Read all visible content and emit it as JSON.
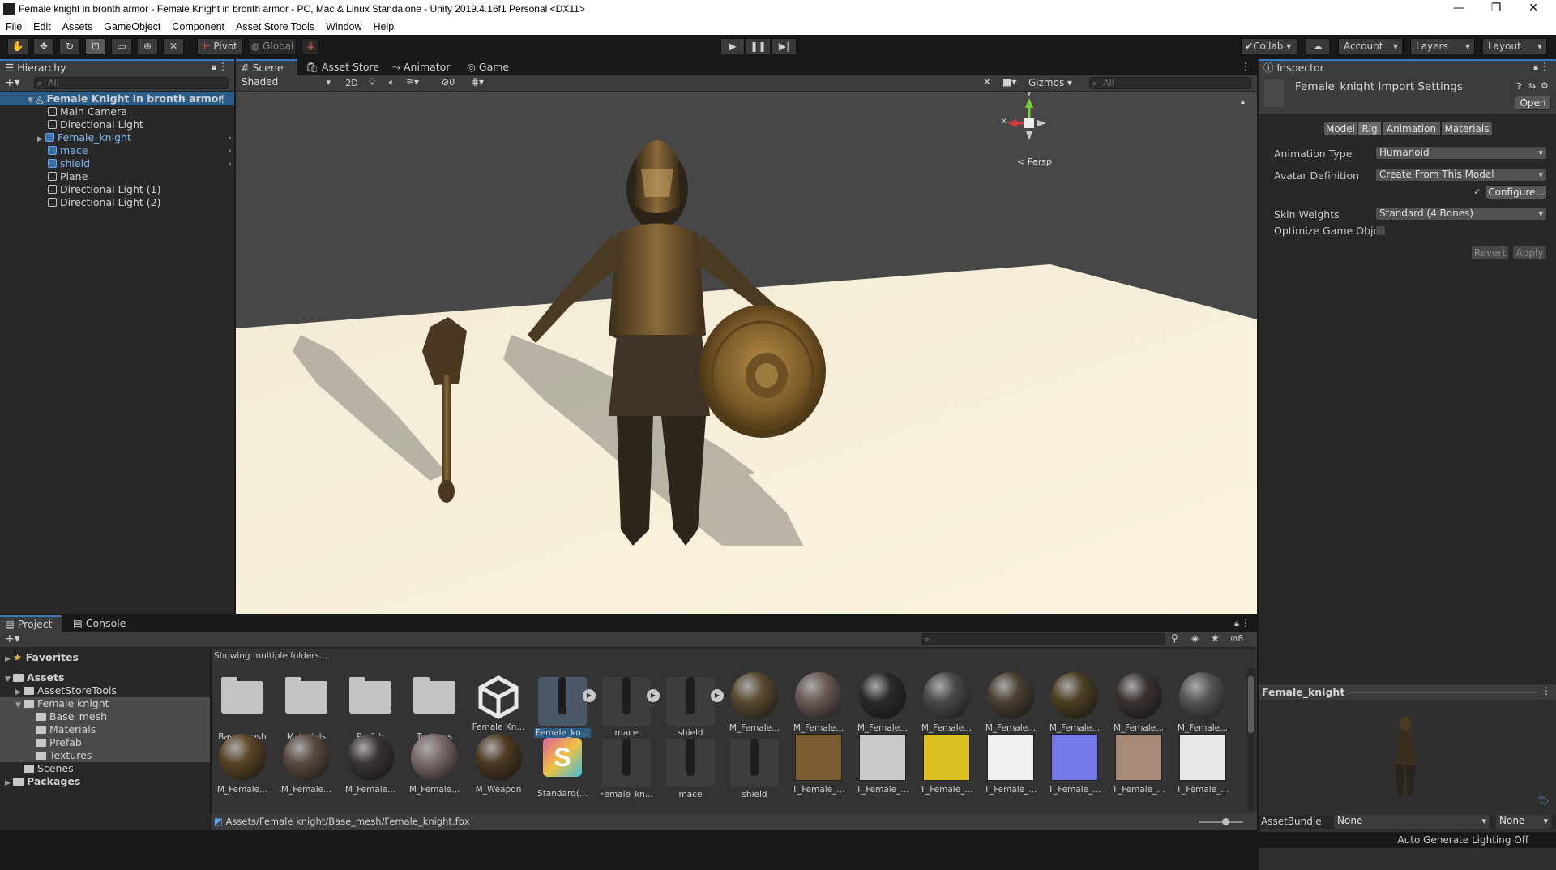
{
  "window": {
    "title": "Female knight in bronth armor - Female Knight in bronth armor - PC, Mac & Linux Standalone - Unity 2019.4.16f1 Personal <DX11>",
    "minimize": "—",
    "maximize": "❐",
    "close": "✕"
  },
  "menu": [
    "File",
    "Edit",
    "Assets",
    "GameObject",
    "Component",
    "Asset Store Tools",
    "Window",
    "Help"
  ],
  "toolbar": {
    "pivot": "Pivot",
    "global": "Global",
    "collab": "Collab",
    "account": "Account",
    "layers": "Layers",
    "layout": "Layout"
  },
  "hierarchy": {
    "tab": "Hierarchy",
    "search_placeholder": "All",
    "scene": "Female Knight in bronth armor",
    "items": [
      {
        "label": "Main Camera"
      },
      {
        "label": "Directional Light"
      },
      {
        "label": "Female_knight"
      },
      {
        "label": "mace"
      },
      {
        "label": "shield"
      },
      {
        "label": "Plane"
      },
      {
        "label": "Directional Light (1)"
      },
      {
        "label": "Directional Light (2)"
      }
    ]
  },
  "scene_view": {
    "tabs": [
      "Scene",
      "Asset Store",
      "Animator",
      "Game"
    ],
    "shading": "Shaded",
    "mode_2d": "2D",
    "hidden_count": "0",
    "gizmos": "Gizmos",
    "search_placeholder": "All",
    "gizmo_y": "y",
    "gizmo_x": "x",
    "persp": "Persp"
  },
  "inspector": {
    "tab": "Inspector",
    "title": "Female_knight Import Settings",
    "open": "Open",
    "tabs": [
      "Model",
      "Rig",
      "Animation",
      "Materials"
    ],
    "active_tab": "Rig",
    "animation_type_label": "Animation Type",
    "animation_type_value": "Humanoid",
    "avatar_def_label": "Avatar Definition",
    "avatar_def_value": "Create From This Model",
    "configure": "Configure...",
    "skin_weights_label": "Skin Weights",
    "skin_weights_value": "Standard (4 Bones)",
    "optimize_label": "Optimize Game Objec",
    "revert": "Revert",
    "apply": "Apply",
    "preview_title": "Female_knight",
    "assetbundle_label": "AssetBundle",
    "assetbundle_value": "None",
    "assetbundle_variant": "None"
  },
  "project": {
    "tabs": [
      "Project",
      "Console"
    ],
    "hidden_count": "8",
    "showing": "Showing multiple folders...",
    "tree": [
      {
        "label": "Favorites",
        "level": 0,
        "kind": "star"
      },
      {
        "label": "Assets",
        "level": 0,
        "kind": "folder"
      },
      {
        "label": "AssetStoreTools",
        "level": 1,
        "kind": "folder"
      },
      {
        "label": "Female knight",
        "level": 1,
        "kind": "folder"
      },
      {
        "label": "Base_mesh",
        "level": 2,
        "kind": "folder"
      },
      {
        "label": "Materials",
        "level": 2,
        "kind": "folder"
      },
      {
        "label": "Prefab",
        "level": 2,
        "kind": "folder"
      },
      {
        "label": "Textures",
        "level": 2,
        "kind": "folder"
      },
      {
        "label": "Scenes",
        "level": 1,
        "kind": "folder"
      },
      {
        "label": "Packages",
        "level": 0,
        "kind": "folder"
      }
    ],
    "row1": [
      {
        "label": "Base_mesh",
        "kind": "folder"
      },
      {
        "label": "Materials",
        "kind": "folder"
      },
      {
        "label": "Prefab",
        "kind": "folder"
      },
      {
        "label": "Textures",
        "kind": "folder"
      },
      {
        "label": "Female Kn...",
        "kind": "unity"
      },
      {
        "label": "Female_kn...",
        "kind": "model",
        "selected": true
      },
      {
        "label": "mace",
        "kind": "model"
      },
      {
        "label": "shield",
        "kind": "model"
      },
      {
        "label": "M_Female...",
        "kind": "sphere",
        "color": "#5a4a30"
      },
      {
        "label": "M_Female...",
        "kind": "sphere",
        "color": "#6a5a55"
      },
      {
        "label": "M_Female...",
        "kind": "sphere",
        "color": "#2b2a2a"
      },
      {
        "label": "M_Female...",
        "kind": "sphere",
        "color": "#4a4a4a"
      },
      {
        "label": "M_Female...",
        "kind": "sphere",
        "color": "#4a3f30"
      },
      {
        "label": "M_Female...",
        "kind": "sphere",
        "color": "#4d3f22"
      },
      {
        "label": "M_Female...",
        "kind": "sphere",
        "color": "#3a3230"
      },
      {
        "label": "M_Female...",
        "kind": "sphere",
        "color": "#555"
      }
    ],
    "row2": [
      {
        "label": "M_Female...",
        "kind": "sphere",
        "color": "#5a4424"
      },
      {
        "label": "M_Female...",
        "kind": "sphere",
        "color": "#5a4a40"
      },
      {
        "label": "M_Female...",
        "kind": "sphere",
        "color": "#3a3434"
      },
      {
        "label": "M_Female...",
        "kind": "sphere",
        "color": "#7a6a68"
      },
      {
        "label": "M_Weapon",
        "kind": "sphere",
        "color": "#4d3a20"
      },
      {
        "label": "Standard(...",
        "kind": "shader"
      },
      {
        "label": "Female_kn...",
        "kind": "model"
      },
      {
        "label": "mace",
        "kind": "model"
      },
      {
        "label": "shield",
        "kind": "model"
      },
      {
        "label": "T_Female_...",
        "kind": "tex",
        "color": "#7a5c30"
      },
      {
        "label": "T_Female_...",
        "kind": "tex",
        "color": "#c9c9c9"
      },
      {
        "label": "T_Female_...",
        "kind": "tex",
        "color": "#d9c020"
      },
      {
        "label": "T_Female_...",
        "kind": "tex",
        "color": "#f0f0f0"
      },
      {
        "label": "T_Female_...",
        "kind": "tex",
        "color": "#7478e8"
      },
      {
        "label": "T_Female_...",
        "kind": "tex",
        "color": "#a88a78"
      },
      {
        "label": "T_Female_...",
        "kind": "tex",
        "color": "#e8e8e8"
      }
    ],
    "path": "Assets/Female knight/Base_mesh/Female_knight.fbx"
  },
  "status": {
    "right": "Auto Generate Lighting Off"
  },
  "colors": {
    "accent": "#3a79bb",
    "panel": "#282828",
    "selected": "#2c5d87"
  }
}
